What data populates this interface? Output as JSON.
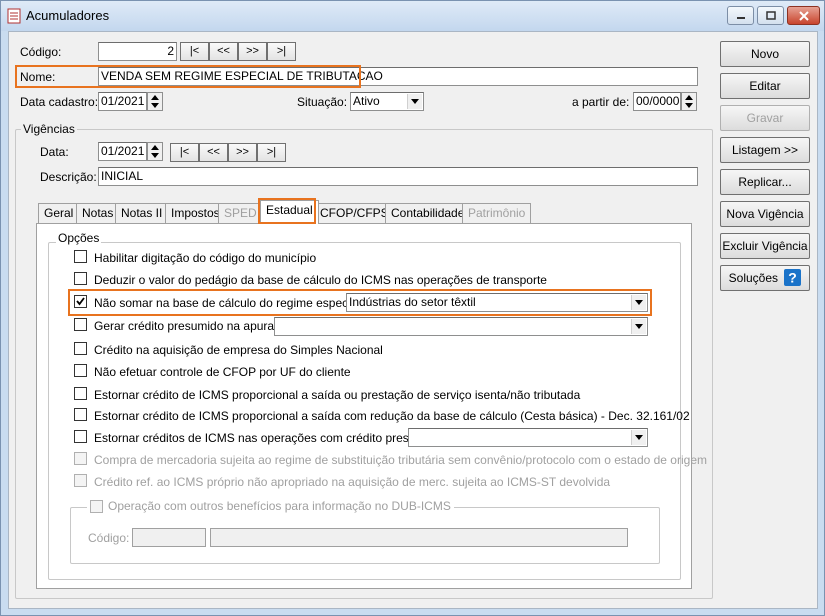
{
  "window": {
    "title": "Acumuladores"
  },
  "header": {
    "codigo_label": "Código:",
    "codigo_value": "2",
    "nav": [
      "|<",
      "<<",
      ">>",
      ">|"
    ],
    "nome_label": "Nome:",
    "nome_value": "VENDA SEM REGIME ESPECIAL DE TRIBUTACAO",
    "data_cadastro_label": "Data cadastro:",
    "data_cadastro_value": "01/2021",
    "situacao_label": "Situação:",
    "situacao_value": "Ativo",
    "a_partir_label": "a partir de:",
    "a_partir_value": "00/0000"
  },
  "vigencias": {
    "title": "Vigências",
    "data_label": "Data:",
    "data_value": "01/2021",
    "nav": [
      "|<",
      "<<",
      ">>",
      ">|"
    ],
    "descricao_label": "Descrição:",
    "descricao_value": "INICIAL"
  },
  "tabs": [
    {
      "label": "Geral",
      "disabled": false
    },
    {
      "label": "Notas",
      "disabled": false
    },
    {
      "label": "Notas II",
      "disabled": false
    },
    {
      "label": "Impostos",
      "disabled": false
    },
    {
      "label": "SPED",
      "disabled": true
    },
    {
      "label": "Estadual",
      "disabled": false,
      "active": true
    },
    {
      "label": "CFOP/CFPS",
      "disabled": false
    },
    {
      "label": "Contabilidade",
      "disabled": false
    },
    {
      "label": "Patrimônio",
      "disabled": true
    }
  ],
  "opcoes": {
    "title": "Opções",
    "items": [
      {
        "label": "Habilitar digitação do código do município",
        "checked": false,
        "disabled": false
      },
      {
        "label": "Deduzir o valor do pedágio da base de cálculo do ICMS nas operações de transporte",
        "checked": false,
        "disabled": false
      },
      {
        "label": "Não somar na base de cálculo do regime especial:",
        "checked": true,
        "disabled": false,
        "combo": "Indústrias do setor têxtil"
      },
      {
        "label": "Gerar crédito presumido na apuração",
        "checked": false,
        "disabled": false,
        "combo": ""
      },
      {
        "label": "Crédito na aquisição de empresa do Simples Nacional",
        "checked": false,
        "disabled": false
      },
      {
        "label": "Não efetuar controle de CFOP por UF do cliente",
        "checked": false,
        "disabled": false
      },
      {
        "label": "Estornar crédito de ICMS proporcional a saída ou prestação de serviço isenta/não tributada",
        "checked": false,
        "disabled": false
      },
      {
        "label": "Estornar crédito de ICMS proporcional a saída com redução da base de cálculo (Cesta básica) - Dec. 32.161/02",
        "checked": false,
        "disabled": false
      },
      {
        "label": "Estornar créditos de ICMS nas operações com crédito presumido",
        "checked": false,
        "disabled": false,
        "combo": ""
      },
      {
        "label": "Compra de mercadoria sujeita ao regime de substituição tributária sem convênio/protocolo com o estado de origem",
        "checked": false,
        "disabled": true
      },
      {
        "label": "Crédito ref. ao ICMS próprio não apropriado na aquisição de merc. sujeita ao ICMS-ST devolvida",
        "checked": false,
        "disabled": true
      }
    ]
  },
  "dub_icms": {
    "title": "Operação com outros benefícios para informação no DUB-ICMS",
    "codigo_label": "Código:"
  },
  "side_buttons": [
    {
      "label": "Novo",
      "disabled": false
    },
    {
      "label": "Editar",
      "disabled": false
    },
    {
      "label": "Gravar",
      "disabled": true
    },
    {
      "label": "Listagem >>",
      "disabled": false
    },
    {
      "label": "Replicar...",
      "disabled": false
    },
    {
      "label": "Nova Vigência",
      "disabled": false
    },
    {
      "label": "Excluir Vigência",
      "disabled": false
    },
    {
      "label": "Soluções",
      "disabled": false
    }
  ],
  "colors": {
    "highlight": "#e8731f",
    "help_icon": "#1a73c9"
  }
}
